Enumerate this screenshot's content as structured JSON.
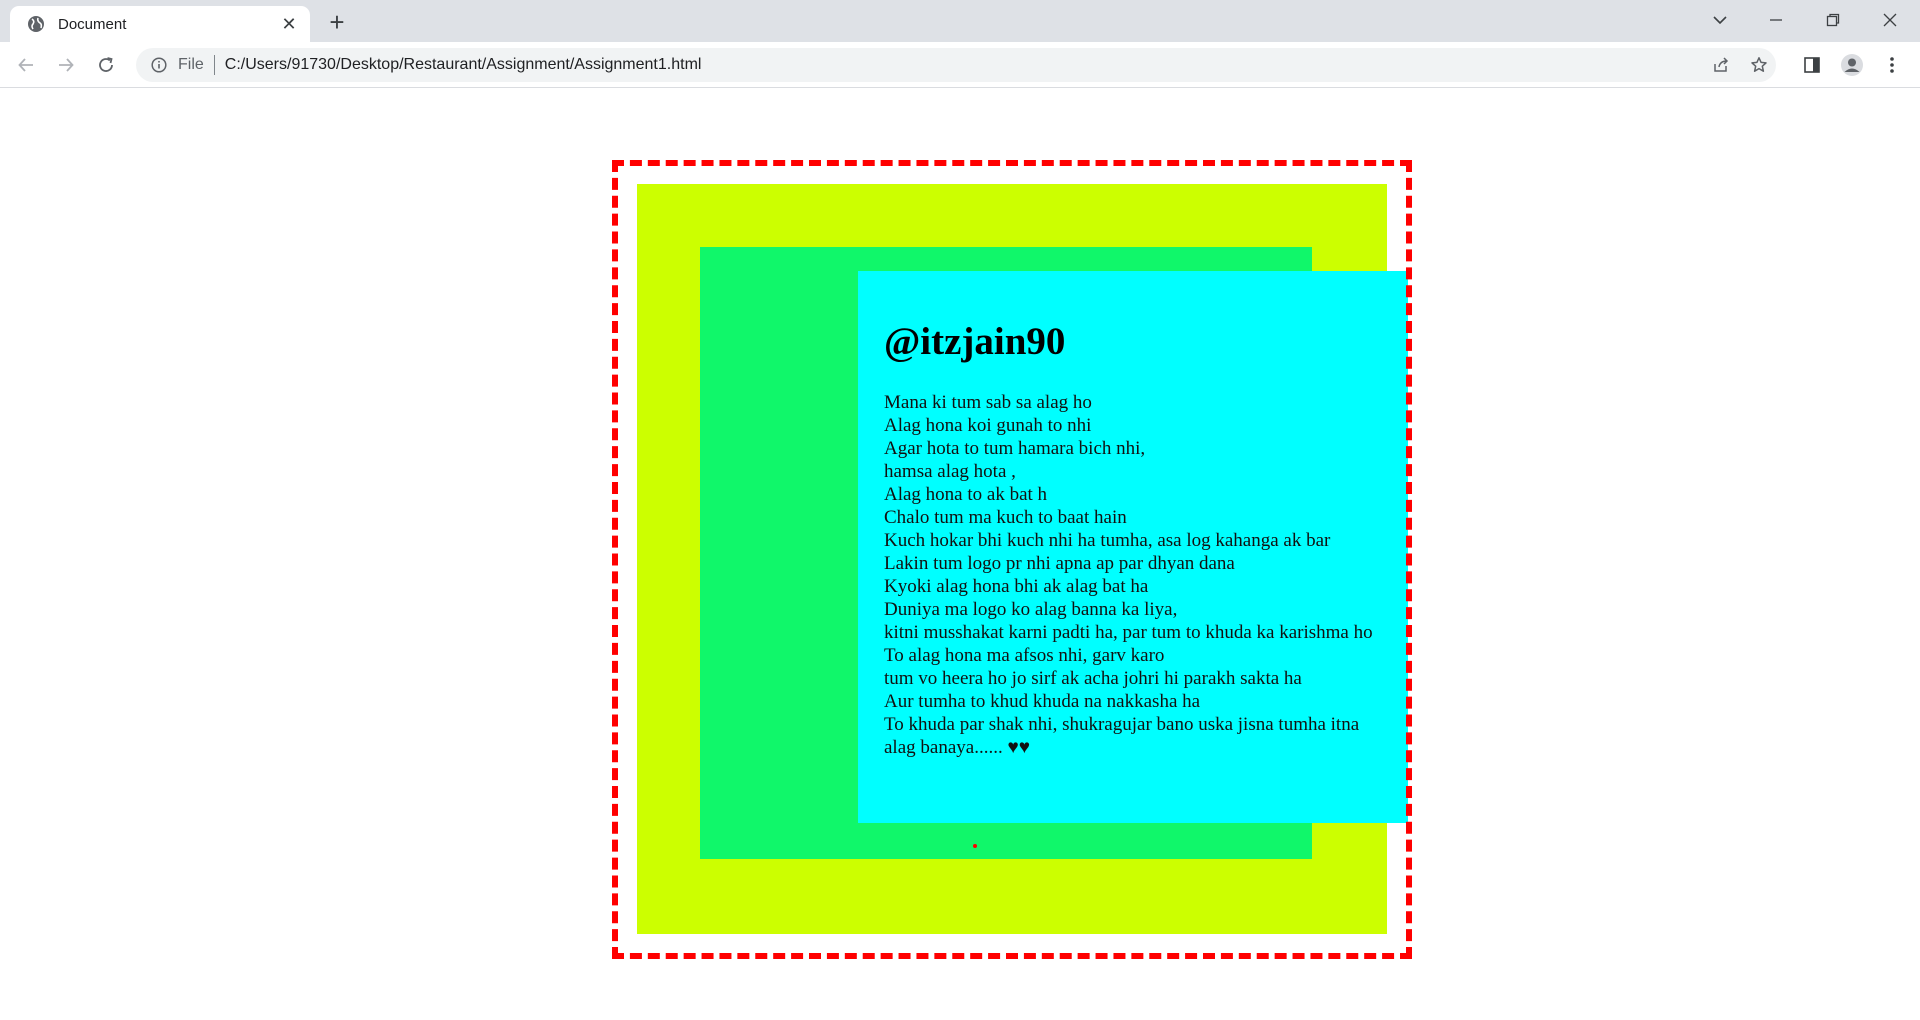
{
  "browser": {
    "tab": {
      "title": "Document",
      "close_symbol": "✕"
    },
    "new_tab_symbol": "+",
    "omnibox": {
      "scheme_label": "File",
      "url": "C:/Users/91730/Desktop/Restaurant/Assignment/Assignment1.html"
    }
  },
  "page": {
    "author": "@itzjain90",
    "poem": [
      "Mana ki tum sab sa alag ho",
      "Alag hona koi gunah to nhi",
      "Agar hota to tum hamara bich nhi,",
      "hamsa alag hota ,",
      "Alag hona to ak bat h",
      "Chalo tum ma kuch to baat hain",
      "Kuch hokar bhi kuch nhi ha tumha, asa log kahanga ak bar",
      "Lakin tum logo pr nhi apna ap par dhyan dana",
      "Kyoki alag hona bhi ak alag bat ha",
      "Duniya ma logo ko alag banna ka liya,",
      "kitni musshakat karni padti ha, par tum to khuda ka karishma ho",
      "To alag hona ma afsos nhi, garv karo",
      "tum vo heera ho jo sirf ak acha johri hi parakh sakta ha",
      "Aur tumha to khud khuda na nakkasha ha",
      "To khuda par shak nhi, shukragujar bano uska jisna tumha itna alag banaya...... ♥♥"
    ],
    "colors": {
      "dashed_border": "#ff0000",
      "outer_box": "#ccff00",
      "middle_box": "#10f76a",
      "inner_box": "#00ffff"
    }
  }
}
